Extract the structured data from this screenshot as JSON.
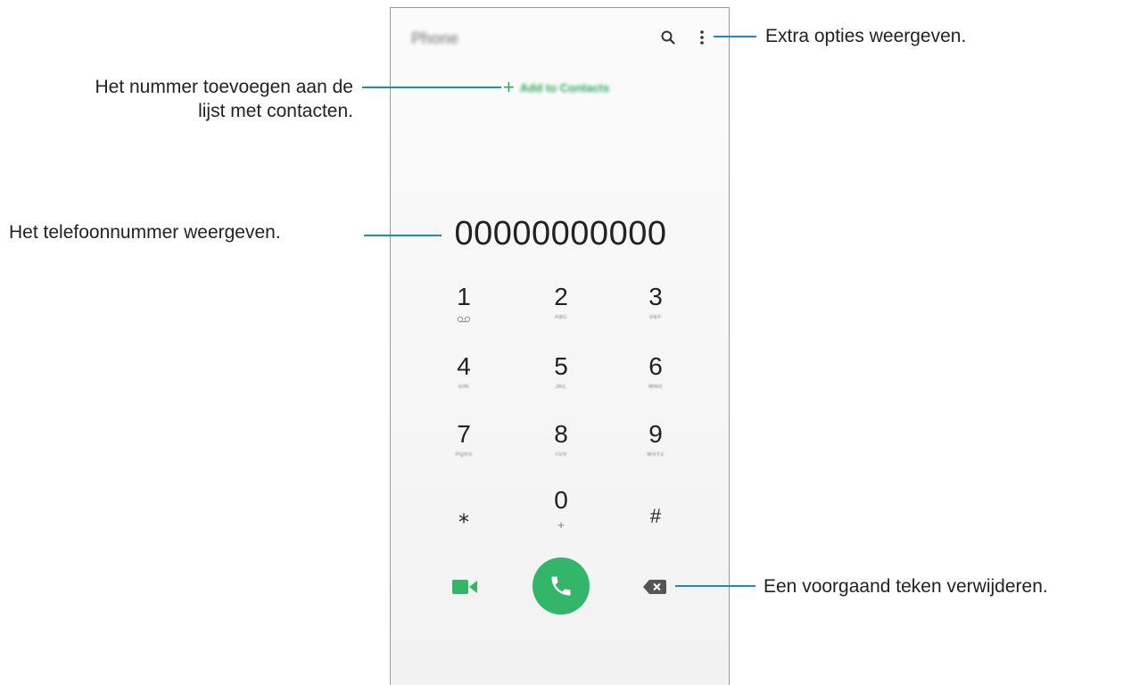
{
  "app": {
    "title": "Phone"
  },
  "toolbar": {
    "search_icon": "search-icon",
    "more_icon": "more-options-icon"
  },
  "add_contacts": {
    "plus": "+",
    "label": "Add to Contacts"
  },
  "dialer": {
    "number": "00000000000"
  },
  "keypad": [
    {
      "digit": "1",
      "letters": ""
    },
    {
      "digit": "2",
      "letters": "ABC"
    },
    {
      "digit": "3",
      "letters": "DEF"
    },
    {
      "digit": "4",
      "letters": "GHI"
    },
    {
      "digit": "5",
      "letters": "JKL"
    },
    {
      "digit": "6",
      "letters": "MNO"
    },
    {
      "digit": "7",
      "letters": "PQRS"
    },
    {
      "digit": "8",
      "letters": "TUV"
    },
    {
      "digit": "9",
      "letters": "WXYZ"
    },
    {
      "digit": "⁎",
      "letters": ""
    },
    {
      "digit": "0",
      "letters": "+"
    },
    {
      "digit": "#",
      "letters": ""
    }
  ],
  "actions": {
    "video_icon": "video-call-icon",
    "call_icon": "phone-icon",
    "backspace_icon": "backspace-icon"
  },
  "annotations": {
    "more_options": "Extra opties weergeven.",
    "add_contact_line1": "Het nummer toevoegen aan de",
    "add_contact_line2": "lijst met contacten.",
    "show_number": "Het telefoonnummer weergeven.",
    "delete_char": "Een voorgaand teken verwijderen."
  },
  "colors": {
    "accent": "#33b56a",
    "callout": "#1d8ac6"
  }
}
